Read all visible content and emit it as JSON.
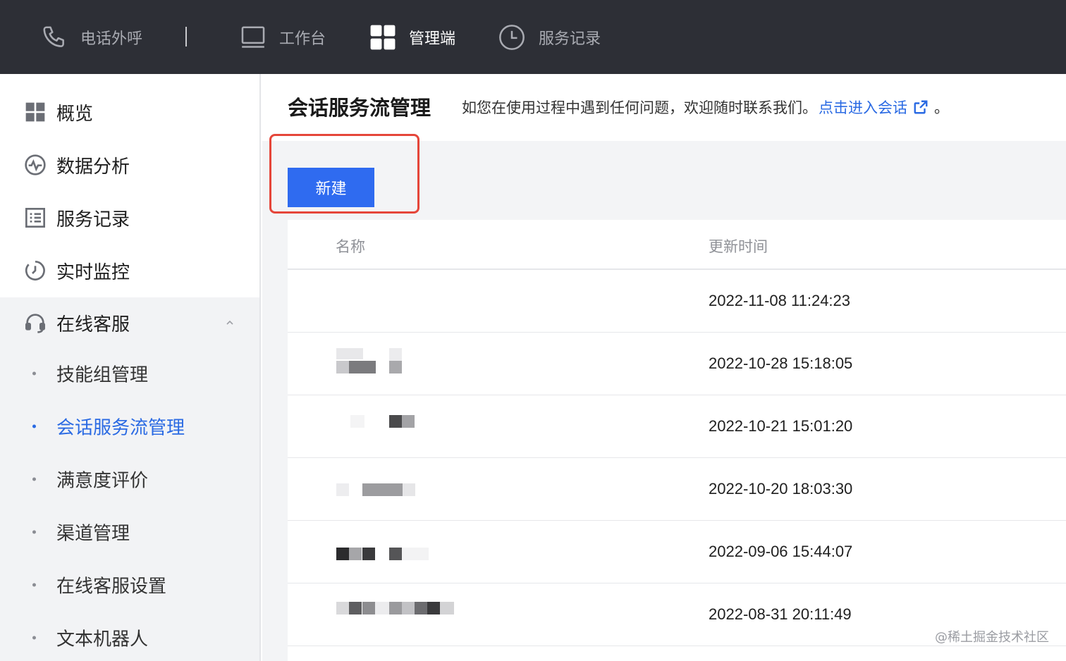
{
  "topbar": {
    "items": [
      {
        "label": "电话外呼",
        "icon": "phone-icon",
        "active": false
      },
      {
        "label": "工作台",
        "icon": "monitor-icon",
        "active": false
      },
      {
        "label": "管理端",
        "icon": "grid-icon",
        "active": true
      },
      {
        "label": "服务记录",
        "icon": "clock-icon",
        "active": false
      }
    ]
  },
  "sidebar": {
    "items": [
      {
        "label": "概览",
        "icon": "grid-icon"
      },
      {
        "label": "数据分析",
        "icon": "pulse-icon"
      },
      {
        "label": "服务记录",
        "icon": "list-icon"
      },
      {
        "label": "实时监控",
        "icon": "refresh-icon"
      }
    ],
    "group": {
      "label": "在线客服",
      "icon": "headset-icon",
      "expanded": true,
      "children": [
        {
          "label": "技能组管理",
          "active": false
        },
        {
          "label": "会话服务流管理",
          "active": true
        },
        {
          "label": "满意度评价",
          "active": false
        },
        {
          "label": "渠道管理",
          "active": false
        },
        {
          "label": "在线客服设置",
          "active": false
        },
        {
          "label": "文本机器人",
          "active": false
        }
      ]
    }
  },
  "main": {
    "title": "会话服务流管理",
    "notice_text": "如您在使用过程中遇到任何问题，欢迎随时联系我们。",
    "notice_link": "点击进入会话",
    "notice_link_icon": "external-link-icon",
    "notice_period": "。",
    "new_button": "新建",
    "table": {
      "columns": [
        "名称",
        "更新时间"
      ],
      "rows": [
        {
          "name": "",
          "updated": "2022-11-08 11:24:23"
        },
        {
          "name": "",
          "updated": "2022-10-28 15:18:05"
        },
        {
          "name": "",
          "updated": "2022-10-21 15:01:20"
        },
        {
          "name": "",
          "updated": "2022-10-20 18:03:30"
        },
        {
          "name": "",
          "updated": "2022-09-06 15:44:07"
        },
        {
          "name": "",
          "updated": "2022-08-31 20:11:49"
        }
      ]
    }
  },
  "watermark": "@稀土掘金技术社区",
  "colors": {
    "topbar_bg": "#2d2f36",
    "accent": "#2a6ae3",
    "button": "#2f6bf0",
    "highlight": "#e5463a"
  }
}
